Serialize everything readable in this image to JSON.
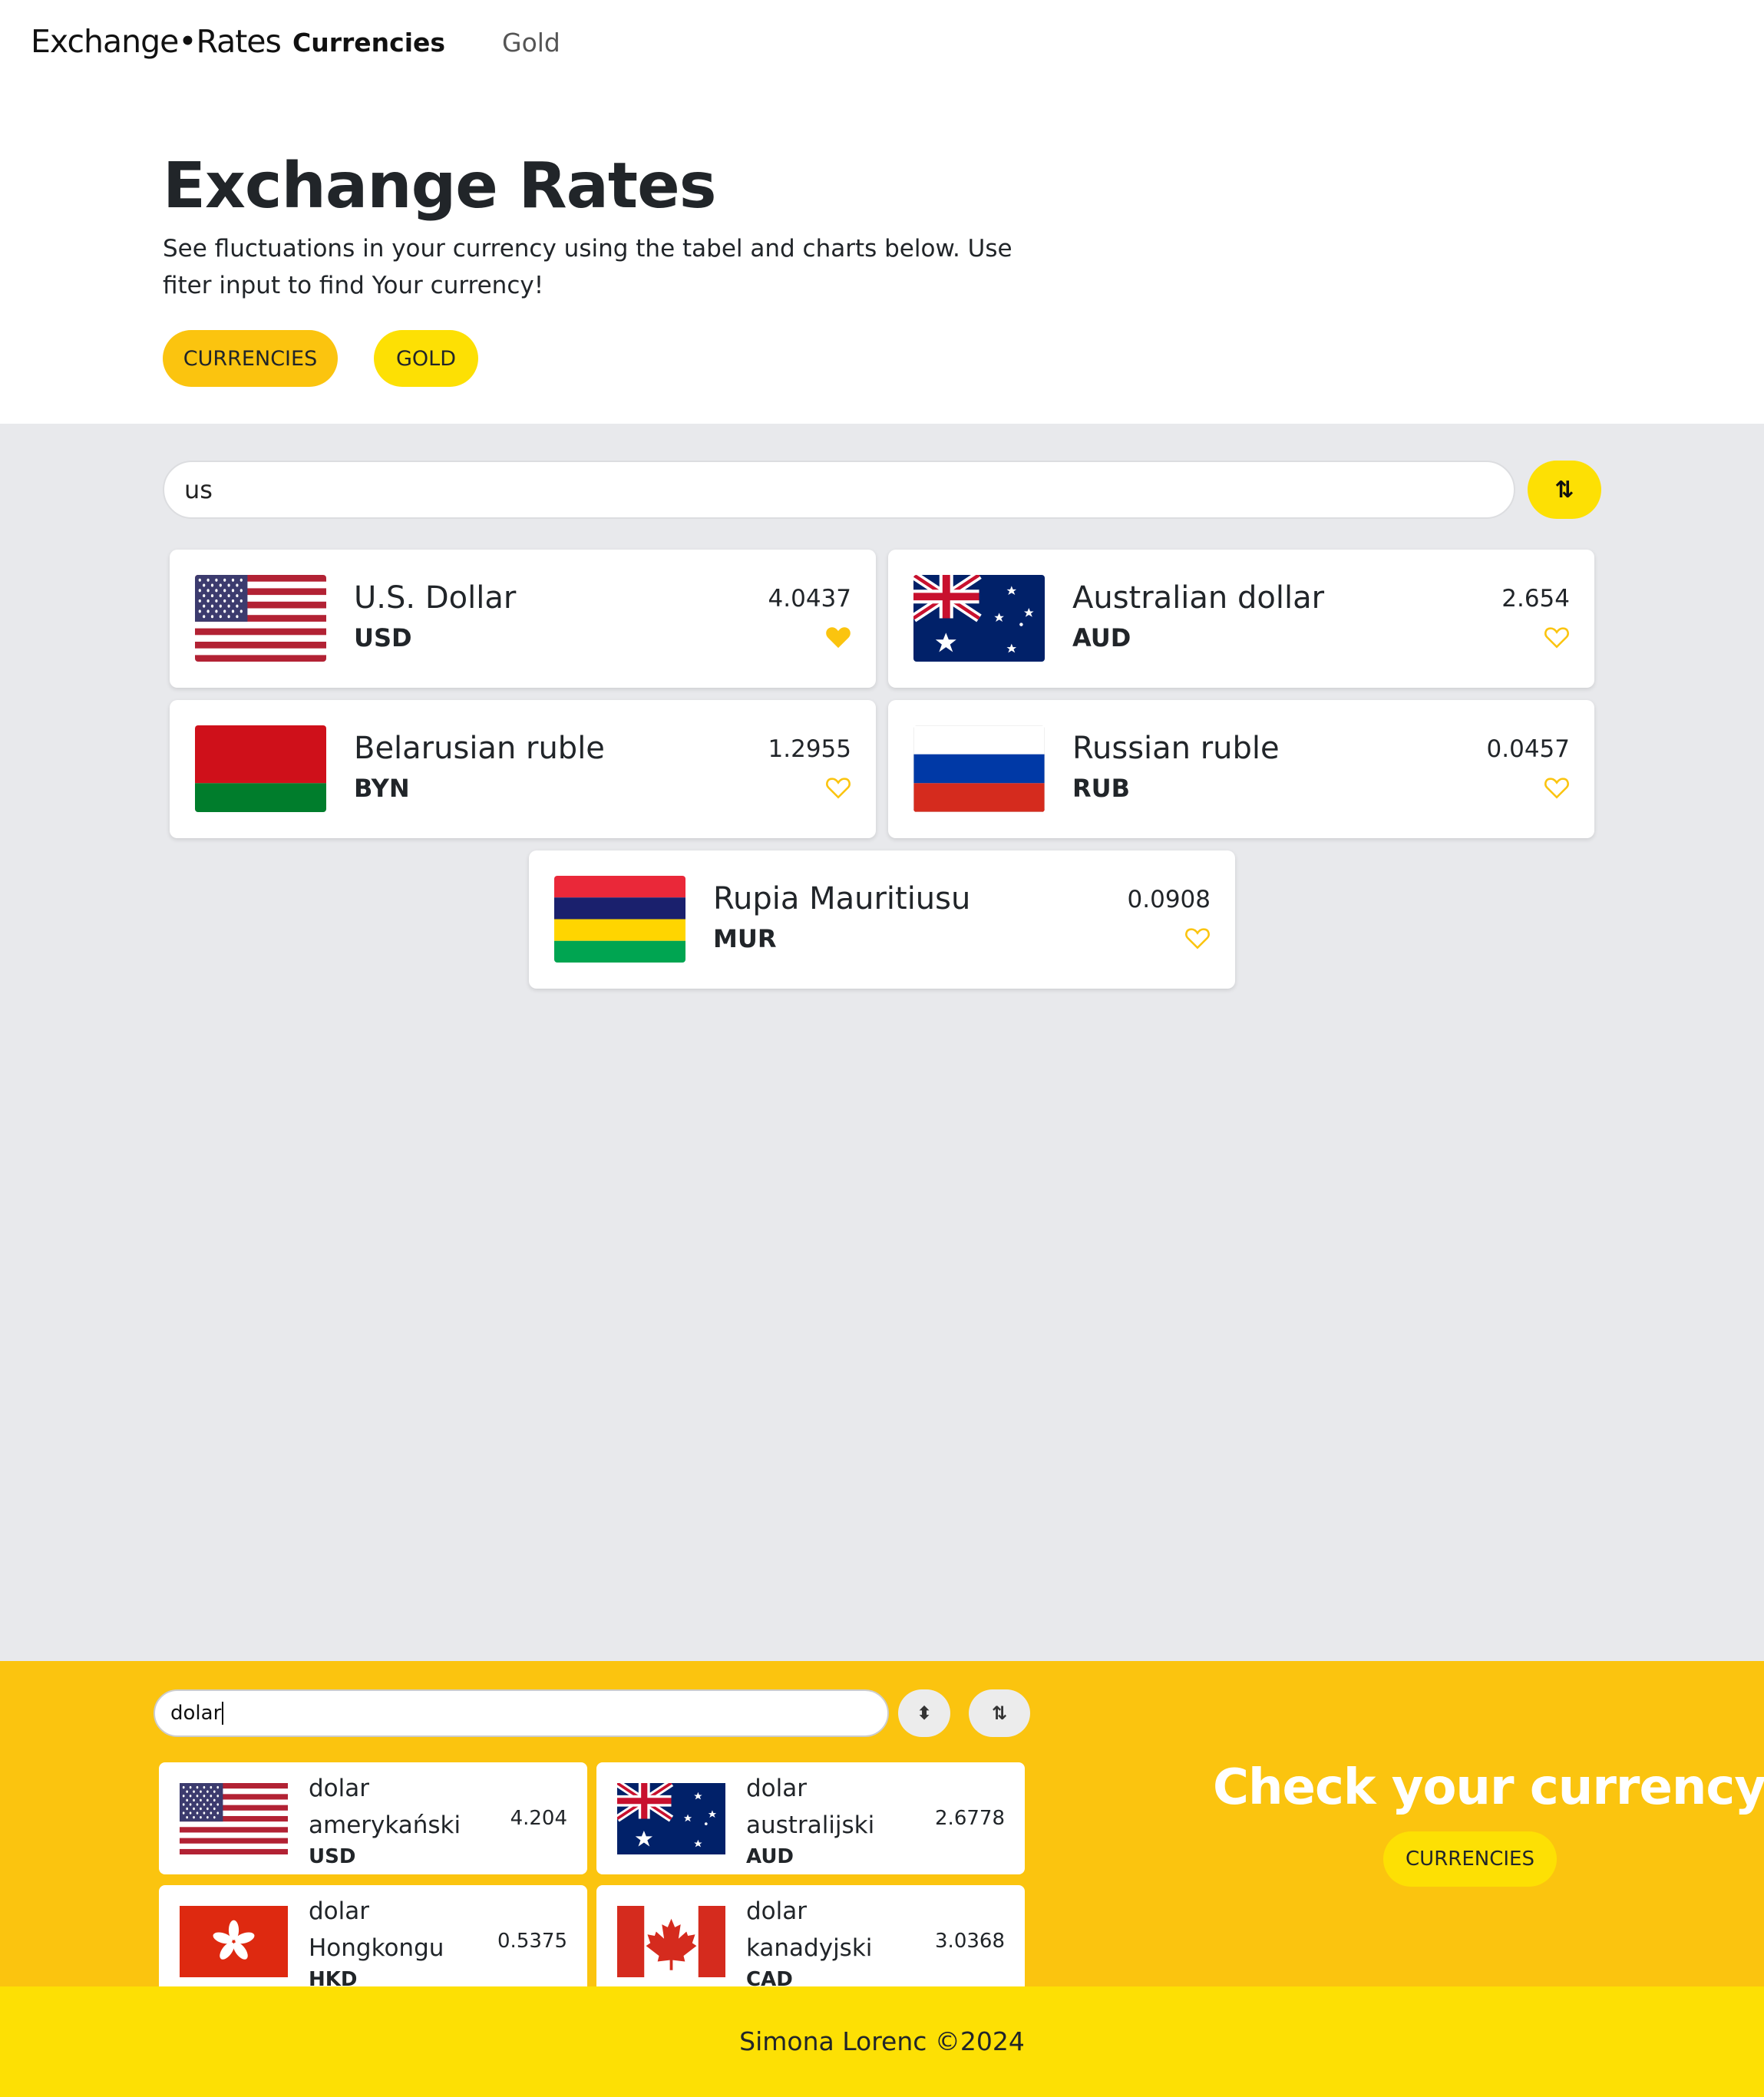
{
  "nav": {
    "brand": "Exchange•Rates",
    "links": [
      {
        "label": "Currencies",
        "active": true
      },
      {
        "label": "Gold",
        "active": false
      }
    ]
  },
  "hero": {
    "title": "Exchange Rates",
    "lead": "See fluctuations in your currency using the tabel and charts below. Use fiter input to find Your currency!",
    "buttons": [
      {
        "label": "CURRENCIES"
      },
      {
        "label": "GOLD"
      }
    ]
  },
  "main": {
    "search_value": "us",
    "sort_icon": "sort-alpha-icon",
    "cards": [
      {
        "name": "U.S. Dollar",
        "code": "USD",
        "rate": "4.0437",
        "favorite": true,
        "flag": "us"
      },
      {
        "name": "Australian dollar",
        "code": "AUD",
        "rate": "2.654",
        "favorite": false,
        "flag": "au"
      },
      {
        "name": "Belarusian ruble",
        "code": "BYN",
        "rate": "1.2955",
        "favorite": false,
        "flag": "by"
      },
      {
        "name": "Russian ruble",
        "code": "RUB",
        "rate": "0.0457",
        "favorite": false,
        "flag": "ru"
      },
      {
        "name": "Rupia Mauritiusu",
        "code": "MUR",
        "rate": "0.0908",
        "favorite": false,
        "flag": "mu"
      }
    ]
  },
  "promo": {
    "search_value": "dolar",
    "title": "Check your currency!",
    "button": "CURRENCIES",
    "cards": [
      {
        "name": "dolar amerykański",
        "code": "USD",
        "rate": "4.204",
        "flag": "us"
      },
      {
        "name": "dolar australijski",
        "code": "AUD",
        "rate": "2.6778",
        "flag": "au"
      },
      {
        "name": "dolar Hongkongu",
        "code": "HKD",
        "rate": "0.5375",
        "flag": "hk"
      },
      {
        "name": "dolar kanadyjski",
        "code": "CAD",
        "rate": "3.0368",
        "flag": "ca"
      }
    ]
  },
  "footer": {
    "text": "Simona Lorenc ©2024"
  },
  "colors": {
    "accent": "#fbc40f",
    "accent_light": "#fde004",
    "background_grey": "#e8e9ec"
  }
}
